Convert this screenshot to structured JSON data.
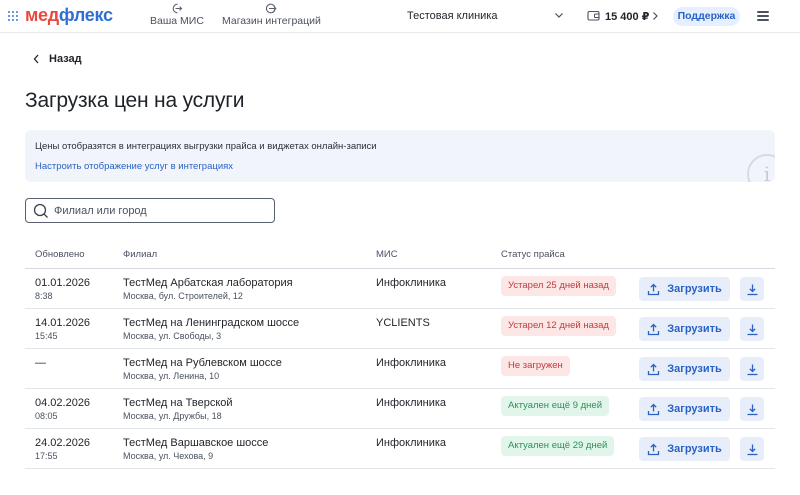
{
  "header": {
    "logo_part1": "мед",
    "logo_part2": "флекс",
    "nav": [
      {
        "label": "Ваша МИС",
        "icon": "logout-arrow-icon"
      },
      {
        "label": "Магазин интеграций",
        "icon": "arrow-circle-icon"
      }
    ],
    "clinic": "Тестовая клиника",
    "balance": "15 400 ₽",
    "support": "Поддержка"
  },
  "back_label": "Назад",
  "page_title": "Загрузка цен на услуги",
  "info": {
    "text": "Цены отобразятся в интеграциях выгрузки прайса и виджетах онлайн-записи",
    "link": "Настроить отображение услуг в интеграциях",
    "badge": "i"
  },
  "search": {
    "placeholder": "Филиал или город",
    "value": ""
  },
  "table": {
    "columns": [
      "Обновлено",
      "Филиал",
      "МИС",
      "Статус прайса"
    ],
    "rows": [
      {
        "date": "01.01.2026",
        "time": "8:38",
        "branch": "ТестМед Арбатская лаборатория",
        "address": "Москва, бул. Строителей, 12",
        "mis": "Инфоклиника",
        "status": "Устарел 25 дней назад",
        "status_type": "bad",
        "upload_label": "Загрузить"
      },
      {
        "date": "14.01.2026",
        "time": "15:45",
        "branch": "ТестМед на Ленинградском шоссе",
        "address": "Москва, ул. Свободы, 3",
        "mis": "YCLIENTS",
        "status": "Устарел 12 дней назад",
        "status_type": "bad",
        "upload_label": "Загрузить"
      },
      {
        "date": "—",
        "time": "",
        "branch": "ТестМед на Рублевском шоссе",
        "address": "Москва, ул. Ленина, 10",
        "mis": "Инфоклиника",
        "status": "Не загружен",
        "status_type": "bad",
        "upload_label": "Загрузить"
      },
      {
        "date": "04.02.2026",
        "time": "08:05",
        "branch": "ТестМед на Тверской",
        "address": "Москва, ул. Дружбы, 18",
        "mis": "Инфоклиника",
        "status": "Актуален ещё 9 дней",
        "status_type": "good",
        "upload_label": "Загрузить"
      },
      {
        "date": "24.02.2026",
        "time": "17:55",
        "branch": "ТестМед Варшавское шоссе",
        "address": "Москва, ул. Чехова, 9",
        "mis": "Инфоклиника",
        "status": "Актуален ещё 29 дней",
        "status_type": "good",
        "upload_label": "Загрузить"
      }
    ]
  },
  "colors": {
    "accent": "#2a62c4",
    "logo_red": "#e8483f",
    "status_bad_bg": "#fde6e6",
    "status_bad_text": "#c33b3b",
    "status_good_bg": "#e1f5ea",
    "status_good_text": "#2f8f57"
  }
}
